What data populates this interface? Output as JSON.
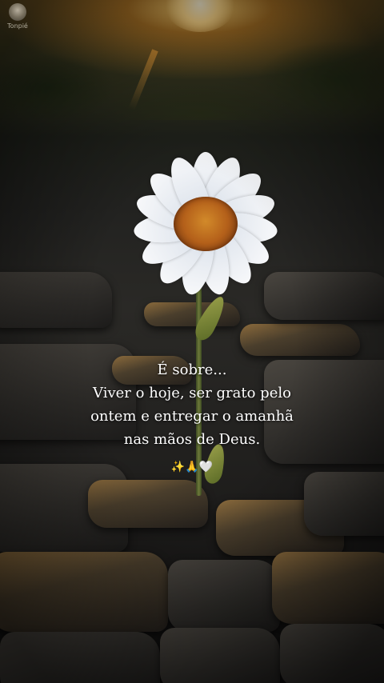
{
  "watermark": {
    "text": "Tonpié"
  },
  "caption": {
    "lines": [
      "É sobre...",
      "Viver o hoje, ser grato pelo",
      "ontem e entregar o amanhã",
      "nas mãos de Deus."
    ],
    "emojis": "✨🙏🤍"
  },
  "colors": {
    "text": "#ffffff",
    "sun": "#ffd98a",
    "flower_center": "#b4601a",
    "petal": "#f7f8fa"
  }
}
